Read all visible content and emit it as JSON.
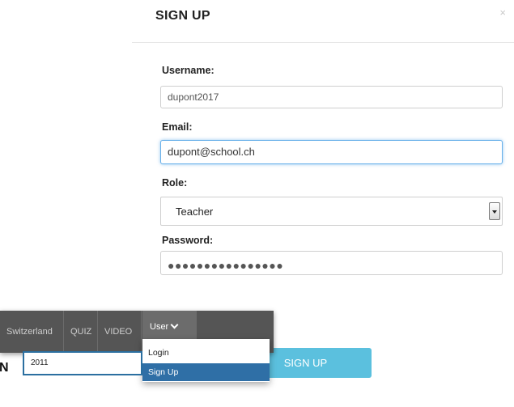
{
  "modal": {
    "title": "SIGN UP",
    "close_symbol": "×",
    "username": {
      "label": "Username:",
      "value": "dupont2017"
    },
    "email": {
      "label": "Email:",
      "value": "dupont@school.ch"
    },
    "role": {
      "label": "Role:",
      "selected": "Teacher"
    },
    "password": {
      "label": "Password:",
      "masked_value": "●●●●●●●●●●●●●●●●"
    },
    "submit_label": "SIGN UP"
  },
  "navbar": {
    "items": [
      "Switzerland",
      "QUIZ",
      "VIDEO"
    ],
    "user_menu": {
      "label": "User",
      "items": [
        "Login",
        "Sign Up"
      ],
      "active": "Sign Up"
    }
  },
  "background": {
    "year_label": "N",
    "year_value": "2011"
  },
  "colors": {
    "accent": "#5bc0de",
    "navbar_bg": "#555555",
    "dropdown_active": "#2f6fa6",
    "focus_border": "#66afe9"
  }
}
